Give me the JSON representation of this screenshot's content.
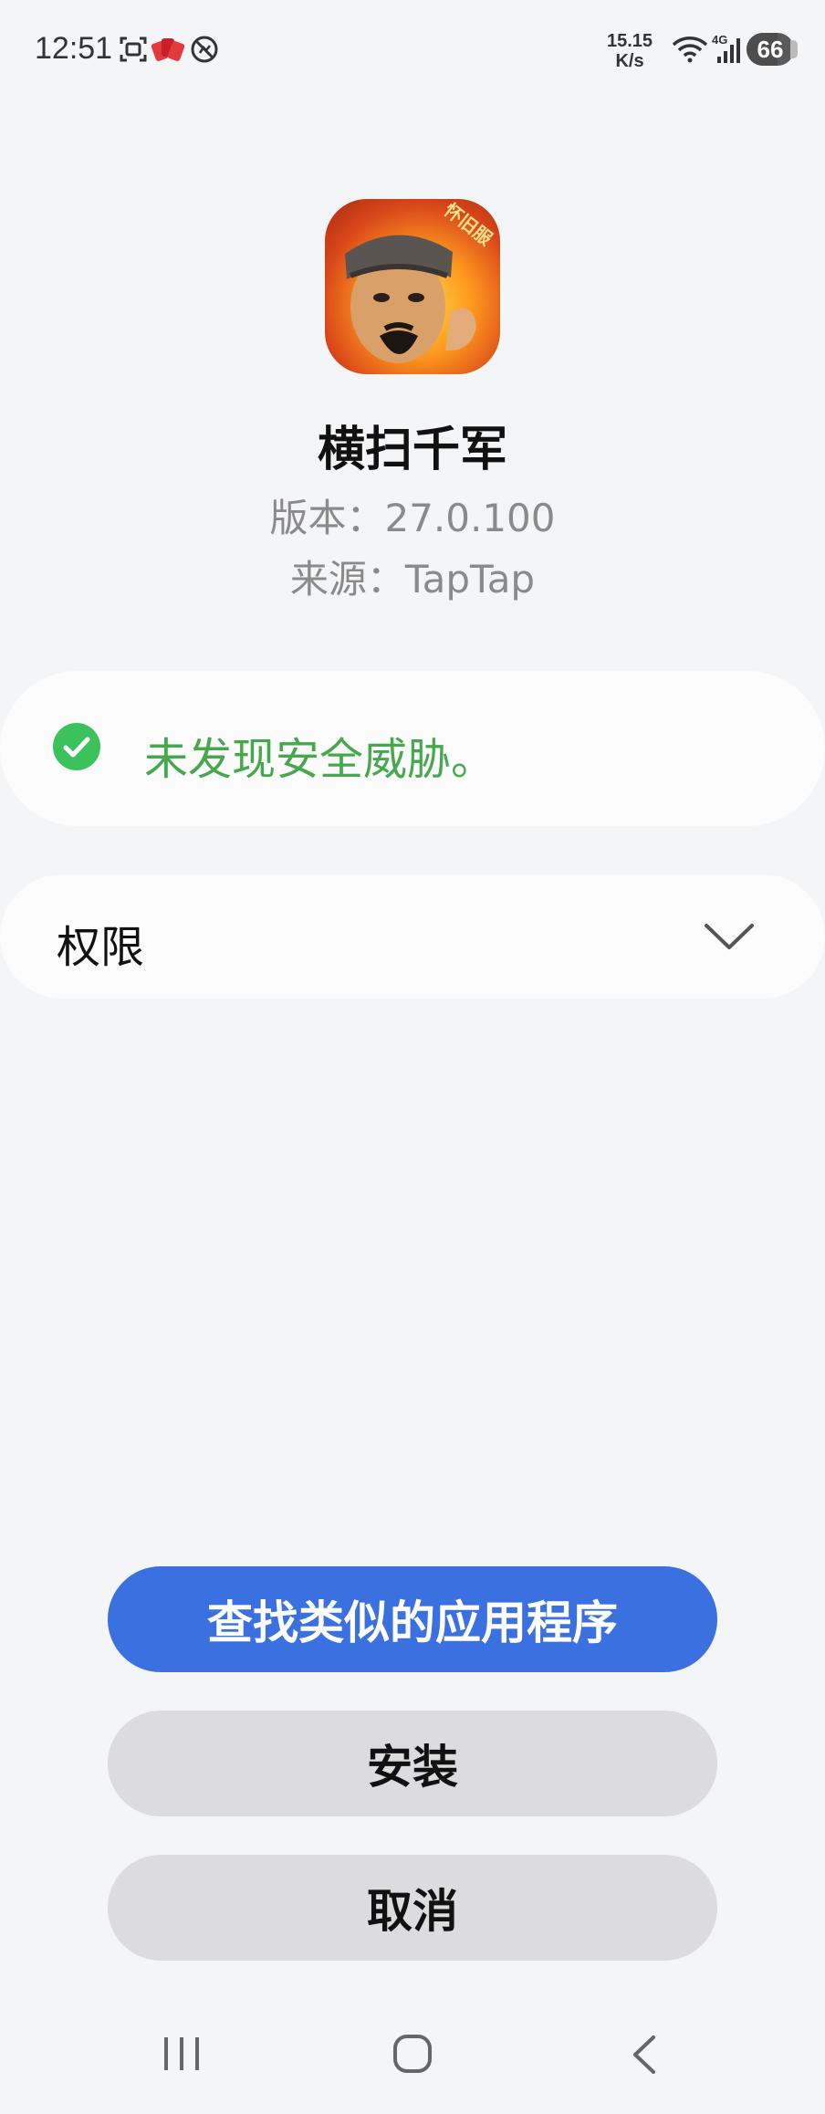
{
  "status_bar": {
    "time": "12:51",
    "net_speed_value": "15.15",
    "net_speed_unit": "K/s",
    "network_type": "4G",
    "battery_level": "66",
    "icons": [
      "screenshot-icon",
      "cards-app-icon",
      "no-disturb-icon",
      "wifi-icon",
      "signal-icon",
      "battery-icon"
    ]
  },
  "app": {
    "name": "横扫千军",
    "version": "版本：27.0.100",
    "source": "来源：TapTap",
    "icon_badge": "怀旧服"
  },
  "security": {
    "message": "未发现安全威胁。",
    "status_color": "#46a84c"
  },
  "permissions": {
    "label": "权限"
  },
  "buttons": {
    "find_similar": "查找类似的应用程序",
    "install": "安装",
    "cancel": "取消"
  },
  "colors": {
    "primary": "#3b70e0",
    "secondary_button": "#dcdcde",
    "background": "#f4f5f7"
  },
  "nav": {
    "items": [
      "recent-apps-icon",
      "home-icon",
      "back-icon"
    ]
  }
}
